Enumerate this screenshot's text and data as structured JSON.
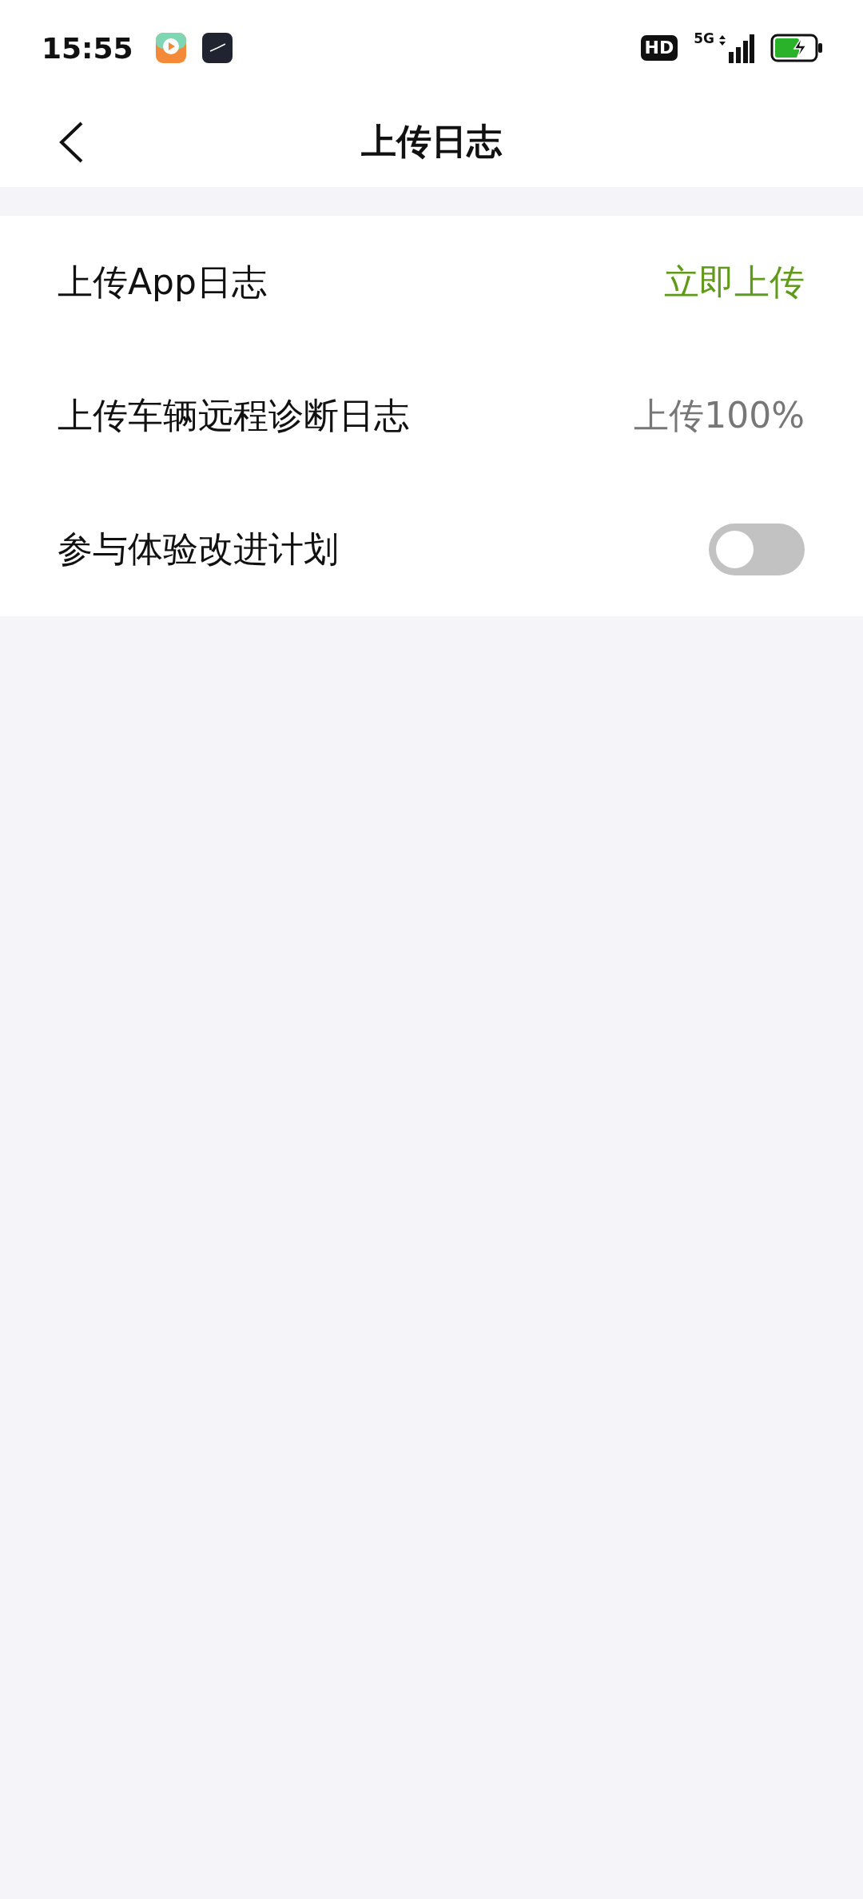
{
  "status_bar": {
    "time": "15:55",
    "hd_badge": "HD",
    "network": "5G"
  },
  "header": {
    "title": "上传日志"
  },
  "settings": [
    {
      "kind": "action",
      "label": "上传App日志",
      "value": "立即上传"
    },
    {
      "kind": "status",
      "label": "上传车辆远程诊断日志",
      "value": "上传100%"
    },
    {
      "kind": "toggle",
      "label": "参与体验改进计划",
      "on": false
    }
  ]
}
